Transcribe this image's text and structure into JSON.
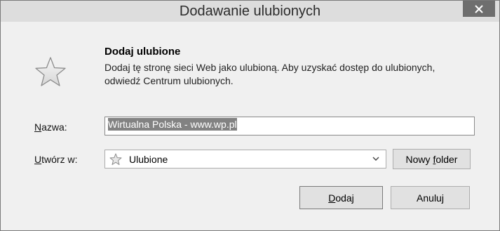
{
  "window": {
    "title": "Dodawanie ulubionych",
    "close_icon": "close-icon"
  },
  "intro": {
    "icon": "star-icon",
    "heading": "Dodaj ulubione",
    "description": "Dodaj tę stronę sieci Web jako ulubioną. Aby uzyskać dostęp do ulubionych, odwiedź Centrum ulubionych."
  },
  "form": {
    "name_label_accel": "N",
    "name_label_rest": "azwa:",
    "name_value": "Wirtualna Polska - www.wp.pl",
    "create_in_label_accel": "U",
    "create_in_label_rest": "twórz w:",
    "folder_selected": "Ulubione",
    "folder_icon": "star-icon"
  },
  "buttons": {
    "new_folder_pre": "Nowy ",
    "new_folder_accel": "f",
    "new_folder_post": "older",
    "add_accel": "D",
    "add_rest": "odaj",
    "cancel": "Anuluj"
  }
}
